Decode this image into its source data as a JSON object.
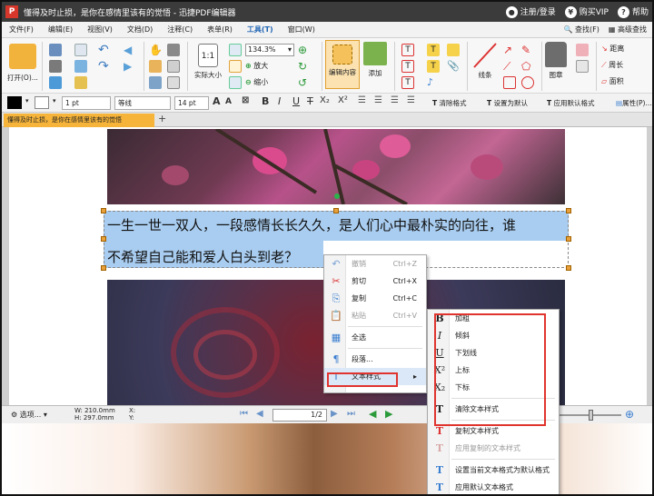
{
  "window": {
    "title": "懂得及时止损，是你在感情里该有的觉悟 - 迅捷PDF编辑器",
    "app_icon": "P",
    "login_label": "注册/登录",
    "vip_label": "购买VIP",
    "help_label": "帮助",
    "login_icon": "user-icon",
    "vip_icon": "yen-icon",
    "help_icon": "question-icon"
  },
  "menu": {
    "items": [
      "文件(F)",
      "编辑(E)",
      "视图(V)",
      "文档(D)",
      "注释(C)",
      "表单(R)",
      "工具(T)",
      "窗口(W)"
    ],
    "right": [
      "查找(F)",
      "高级查找"
    ]
  },
  "ribbon": {
    "open_label": "打开(O)...",
    "actual_size_label": "实际大小",
    "zoom_value": "134.3%",
    "zoom_in_label": "放大",
    "zoom_out_label": "缩小",
    "edit_content_label": "编辑内容",
    "add_label": "添加",
    "line_label": "线条",
    "stamp_label": "图章",
    "distance_label": "距离",
    "perimeter_label": "周长",
    "area_label": "面积"
  },
  "format_bar": {
    "line_width": "1 pt",
    "line_style": "等线",
    "font_size": "14 pt",
    "bold": "B",
    "italic": "I",
    "underline": "U",
    "clear_format_label": "清除格式",
    "set_default_label": "设置为默认",
    "apply_default_label": "应用默认格式",
    "properties_label": "属性(P)..."
  },
  "tab": {
    "label": "懂得及时止损，是你在感情里该有的觉悟"
  },
  "document": {
    "line1": "一生一世一双人，一段感情长长久久，是人们心中最朴实的向往，谁",
    "line2": "不希望自己能和爱人白头到老？"
  },
  "status": {
    "select_label": "选项...",
    "width": "W: 210.0mm",
    "height": "H: 297.0mm",
    "x": "X:",
    "y": "Y:",
    "page_value": "1",
    "page_total": "/2"
  },
  "context_menu": {
    "items": [
      {
        "label": "撤销",
        "shortcut": "Ctrl+Z",
        "disabled": true,
        "icon": "undo-icon"
      },
      {
        "label": "剪切",
        "shortcut": "Ctrl+X",
        "disabled": false,
        "icon": "scissors-icon"
      },
      {
        "label": "复制",
        "shortcut": "Ctrl+C",
        "disabled": false,
        "icon": "copy-icon"
      },
      {
        "label": "粘贴",
        "shortcut": "Ctrl+V",
        "disabled": true,
        "icon": "paste-icon"
      },
      {
        "label": "全选",
        "shortcut": "",
        "disabled": false,
        "icon": "select-all-icon"
      },
      {
        "label": "段落...",
        "shortcut": "",
        "disabled": false,
        "icon": "paragraph-icon"
      },
      {
        "label": "文本样式",
        "shortcut": "",
        "disabled": false,
        "icon": "text-style-icon"
      }
    ]
  },
  "submenu": {
    "items": [
      {
        "label": "加粗",
        "glyph": "B"
      },
      {
        "label": "倾斜",
        "glyph": "I"
      },
      {
        "label": "下划线",
        "glyph": "U"
      },
      {
        "label": "上标",
        "glyph": "X²"
      },
      {
        "label": "下标",
        "glyph": "X₂"
      },
      {
        "label": "清除文本样式",
        "glyph": "T"
      },
      {
        "label": "复制文本样式",
        "glyph": "T"
      },
      {
        "label": "应用复制的文本样式",
        "glyph": "T"
      },
      {
        "label": "设置当前文本格式为默认格式",
        "glyph": "T"
      },
      {
        "label": "应用默认文本格式",
        "glyph": "T"
      }
    ]
  },
  "colors": {
    "accent_orange": "#f6b43a",
    "highlight_red": "#e0342f",
    "selection_blue": "#a9cdf0"
  }
}
